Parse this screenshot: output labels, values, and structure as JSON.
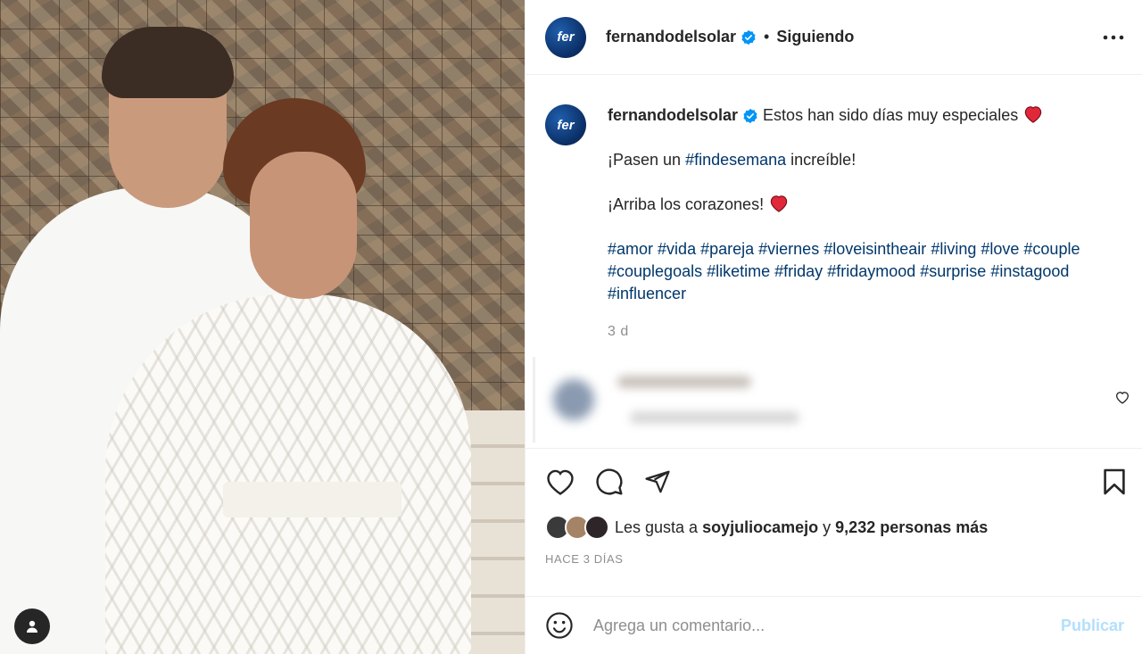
{
  "post": {
    "username": "fernandodelsolar",
    "avatar_text": "fer",
    "follow_status": "Siguiendo",
    "separator": "•",
    "caption": {
      "line1": "Estos han sido días muy especiales",
      "line2_prefix": "¡Pasen un ",
      "line2_tag": "#findesemana",
      "line2_suffix": " increíble!",
      "line3": "¡Arriba los corazones!",
      "hashtags": [
        "#amor",
        "#vida",
        "#pareja",
        "#viernes",
        "#loveisintheair",
        "#living",
        "#love",
        "#couple",
        "#couplegoals",
        "#liketime",
        "#friday",
        "#fridaymood",
        "#surprise",
        "#instagood",
        "#influencer"
      ],
      "time": "3 d"
    },
    "likes": {
      "prefix": "Les gusta a",
      "liker": "soyjuliocamejo",
      "connector": "y",
      "others": "9,232 personas más"
    },
    "time_ago": "HACE 3 DÍAS",
    "comment_input": {
      "placeholder": "Agrega un comentario..."
    },
    "publish_label": "Publicar"
  },
  "colors": {
    "hashtag": "#00376b",
    "verified": "#0095f6",
    "publish_disabled": "#b2dffc",
    "heart": "#ed4956"
  },
  "icons": [
    "verified-icon",
    "more-options-icon",
    "heart-emoji-icon",
    "like-icon",
    "comment-icon",
    "share-icon",
    "save-icon",
    "emoji-icon",
    "user-tag-icon",
    "comment-like-icon"
  ]
}
